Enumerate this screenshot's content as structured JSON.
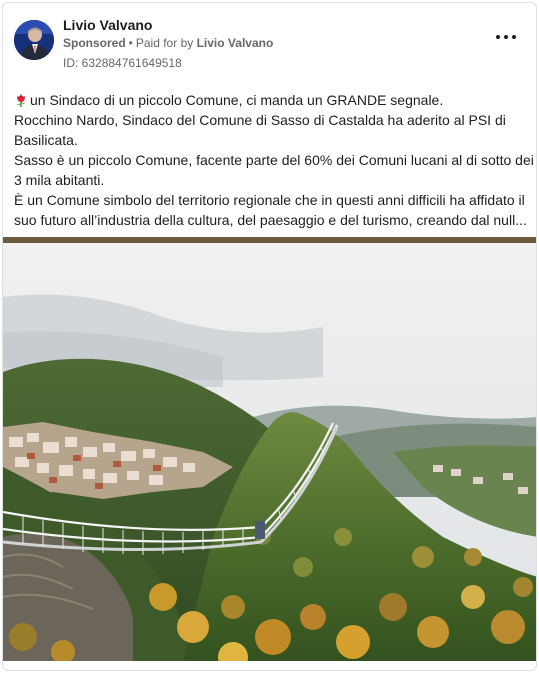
{
  "post": {
    "author_name": "Livio Valvano",
    "sponsored_label": "Sponsored",
    "separator": "•",
    "paid_for_label": "Paid for by",
    "paid_for_name": "Livio Valvano",
    "ad_id": "ID: 632884761649518",
    "more_options_icon": "more-horizontal-icon",
    "emoji_icon": "rose-icon",
    "lines": [
      "un Sindaco di un piccolo Comune, ci manda un GRANDE segnale.",
      "Rocchino Nardo, Sindaco del Comune di Sasso di Castalda ha aderito al PSI di Basilicata.",
      "Sasso è un piccolo Comune, facente parte del 60% dei Comuni lucani al di sotto dei 3 mila abitanti.",
      "È un Comune simbolo del territorio regionale che in questi anni difficili ha affidato il suo futuro all’industria della cultura, del paesaggio e del turismo, creando dal null..."
    ]
  },
  "colors": {
    "text": "#1c1e21",
    "secondary_text": "#65676b",
    "border": "#dcdfe4"
  }
}
